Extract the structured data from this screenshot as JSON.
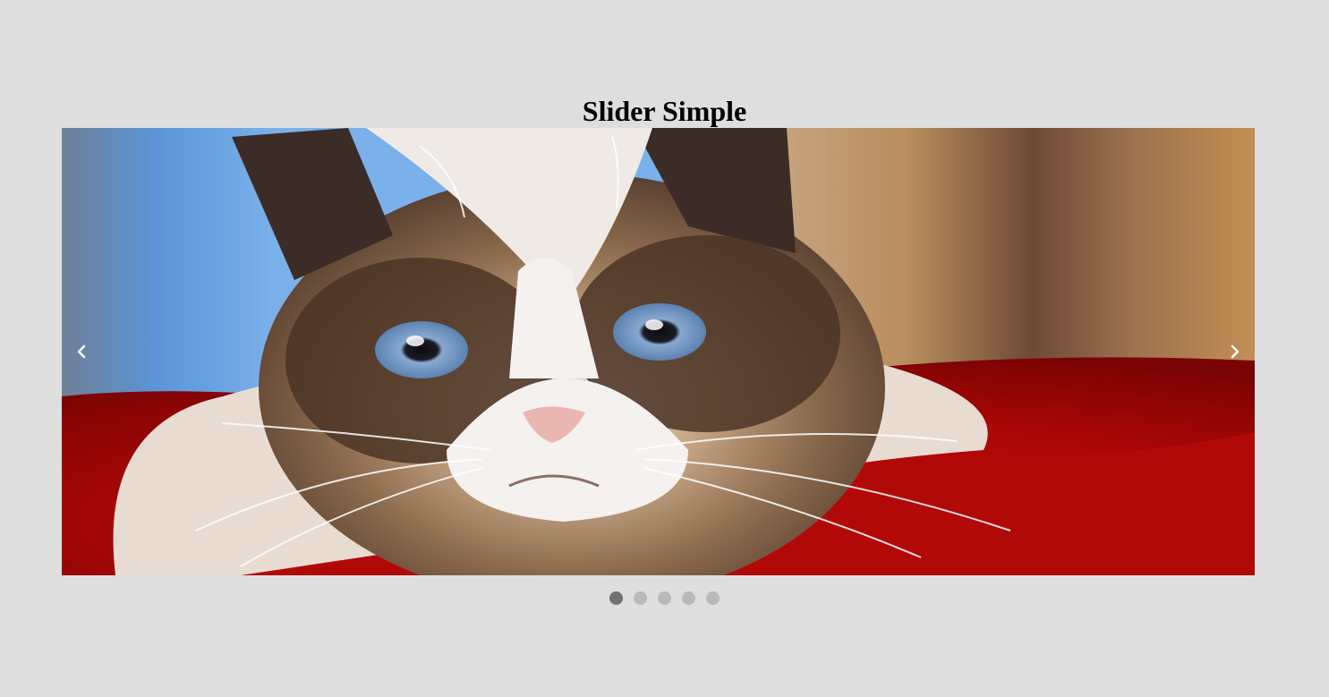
{
  "page": {
    "title": "Slider Simple"
  },
  "slider": {
    "current_slide": 1,
    "slide_count": 5,
    "slide_image": "grumpy-cat-on-red-pillow",
    "prev_icon": "chevron-left-icon",
    "next_icon": "chevron-right-icon",
    "dots": [
      {
        "index": 1,
        "active": true
      },
      {
        "index": 2,
        "active": false
      },
      {
        "index": 3,
        "active": false
      },
      {
        "index": 4,
        "active": false
      },
      {
        "index": 5,
        "active": false
      }
    ]
  },
  "colors": {
    "background": "#dedede",
    "dot_inactive": "#b9b9b9",
    "dot_active": "#717171",
    "arrow": "#ffffff"
  }
}
